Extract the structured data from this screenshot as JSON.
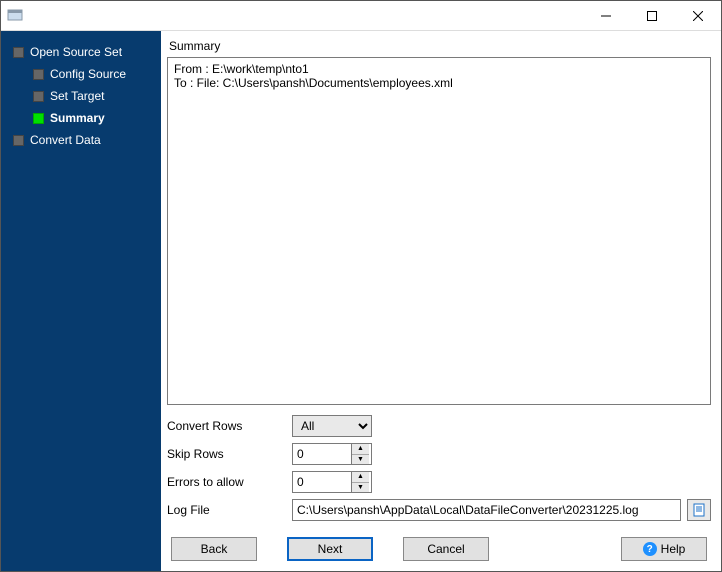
{
  "window": {
    "title": ""
  },
  "sidebar": {
    "items": [
      {
        "label": "Open Source Set",
        "level": "root",
        "active": false
      },
      {
        "label": "Config Source",
        "level": "child",
        "active": false
      },
      {
        "label": "Set Target",
        "level": "child",
        "active": false
      },
      {
        "label": "Summary",
        "level": "child",
        "active": true
      },
      {
        "label": "Convert Data",
        "level": "root2",
        "active": false
      }
    ]
  },
  "main": {
    "section_label": "Summary",
    "summary_text": "From : E:\\work\\temp\\nto1\nTo : File: C:\\Users\\pansh\\Documents\\employees.xml",
    "form": {
      "convert_rows_label": "Convert Rows",
      "convert_rows_value": "All",
      "skip_rows_label": "Skip Rows",
      "skip_rows_value": "0",
      "errors_label": "Errors to allow",
      "errors_value": "0",
      "log_file_label": "Log File",
      "log_file_value": "C:\\Users\\pansh\\AppData\\Local\\DataFileConverter\\20231225.log"
    }
  },
  "buttons": {
    "back": "Back",
    "next": "Next",
    "cancel": "Cancel",
    "help": "Help"
  }
}
